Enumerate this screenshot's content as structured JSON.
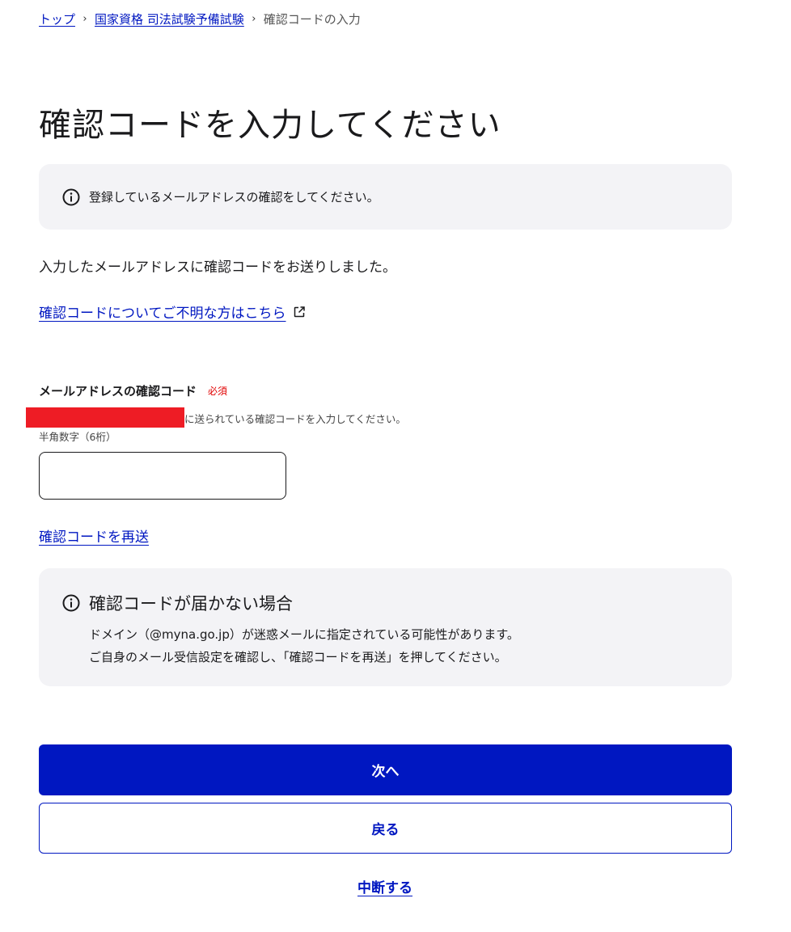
{
  "breadcrumb": {
    "items": [
      {
        "label": "トップ",
        "link": true
      },
      {
        "label": "国家資格 司法試験予備試験",
        "link": true
      },
      {
        "label": "確認コードの入力",
        "link": false
      }
    ],
    "separator": "›"
  },
  "page_title": "確認コードを入力してください",
  "notice_top": {
    "icon": "info-icon",
    "text": "登録しているメールアドレスの確認をしてください。"
  },
  "sent_message": "入力したメールアドレスに確認コードをお送りしました。",
  "help_link": {
    "label": "確認コードについてご不明な方はこちら",
    "icon": "external-link-icon"
  },
  "form": {
    "field_label": "メールアドレスの確認コード",
    "required_label": "必須",
    "description": "に送られている確認コードを入力してください。",
    "hint": "半角数字（6桁）",
    "input_value": "",
    "input_placeholder": ""
  },
  "resend_link": "確認コードを再送",
  "notice_help": {
    "icon": "info-icon",
    "title": "確認コードが届かない場合",
    "line1": "ドメイン（@myna.go.jp）が迷惑メールに指定されている可能性があります。",
    "line2": "ご自身のメール受信設定を確認し、「確認コードを再送」を押してください。"
  },
  "buttons": {
    "next": "次へ",
    "back": "戻る"
  },
  "suspend_link": "中断する",
  "colors": {
    "primary": "#0017c1",
    "notice_bg": "#f3f3f6",
    "required": "#e00000",
    "redaction": "#ee1c25"
  }
}
